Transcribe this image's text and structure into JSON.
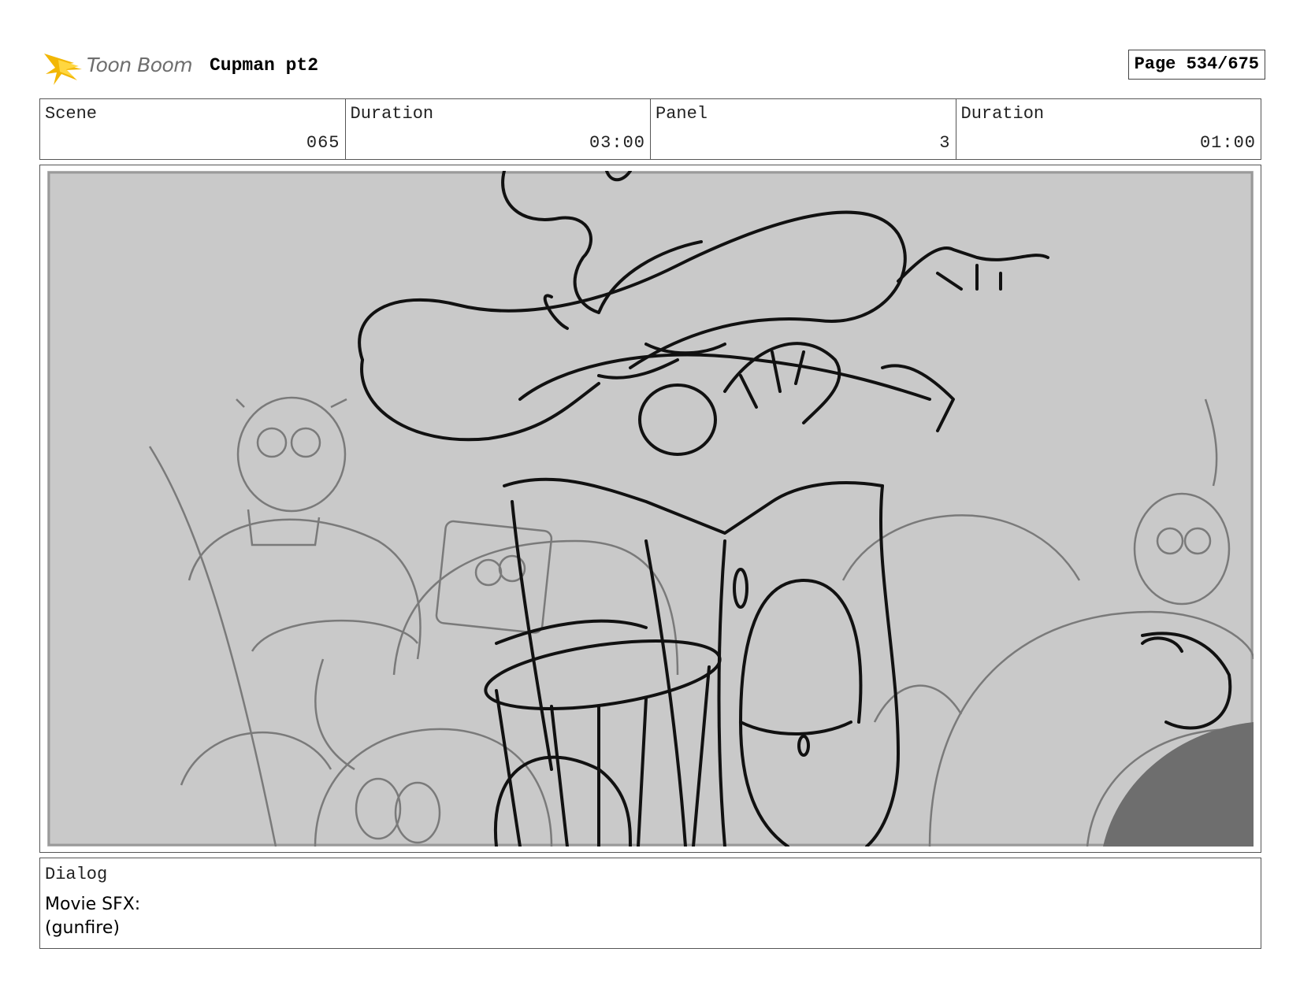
{
  "header": {
    "logo_text": "Toon Boom",
    "project_title": "Cupman pt2",
    "page_label": "Page 534/675"
  },
  "info": [
    {
      "label": "Scene",
      "value": "065"
    },
    {
      "label": "Duration",
      "value": "03:00"
    },
    {
      "label": "Panel",
      "value": "3"
    },
    {
      "label": "Duration",
      "value": "01:00"
    }
  ],
  "panel": {
    "description_icon": "storyboard-sketch"
  },
  "dialog": {
    "label": "Dialog",
    "lines": [
      "Movie SFX:",
      "(gunfire)"
    ]
  },
  "colors": {
    "sketch_background": "#c8c8c8",
    "logo_flame": "#f2b705"
  }
}
